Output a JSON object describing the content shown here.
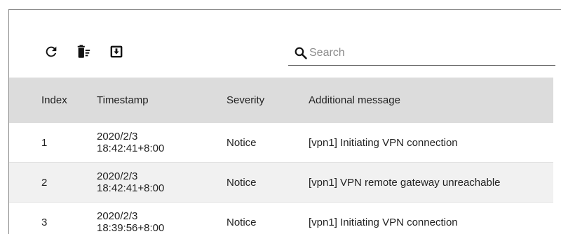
{
  "toolbar": {
    "refresh_icon": "refresh-icon",
    "clear_icon": "clear-log-icon",
    "download_icon": "download-icon"
  },
  "search": {
    "placeholder": "Search",
    "value": ""
  },
  "table": {
    "headers": {
      "index": "Index",
      "timestamp": "Timestamp",
      "severity": "Severity",
      "message": "Additional message"
    },
    "rows": [
      {
        "index": "1",
        "date": "2020/2/3",
        "time": "18:42:41+8:00",
        "severity": "Notice",
        "message": "[vpn1] Initiating VPN connection"
      },
      {
        "index": "2",
        "date": "2020/2/3",
        "time": "18:42:41+8:00",
        "severity": "Notice",
        "message": "[vpn1] VPN remote gateway unreachable"
      },
      {
        "index": "3",
        "date": "2020/2/3",
        "time": "18:39:56+8:00",
        "severity": "Notice",
        "message": "[vpn1] Initiating VPN connection"
      }
    ]
  },
  "colors": {
    "header_bg": "#dcdcdc",
    "alt_row_bg": "#f1f1f1",
    "text": "#222222"
  }
}
